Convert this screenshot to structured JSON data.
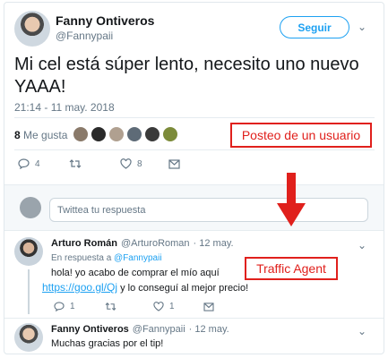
{
  "tweet": {
    "author_name": "Fanny Ontiveros",
    "author_handle": "@Fannypaii",
    "follow_label": "Seguir",
    "text": "Mi cel está súper lento, necesito uno nuevo YAAA!",
    "timestamp": "21:14 - 11 may. 2018",
    "likes_number": "8",
    "likes_label": "Me gusta",
    "reply_count": "4",
    "retweet_count": "",
    "like_count": "8"
  },
  "annotations": {
    "user_post": "Posteo de un usuario",
    "traffic_agent": "Traffic Agent"
  },
  "reply_composer": {
    "placeholder": "Twittea tu respuesta"
  },
  "reply1": {
    "author_name": "Arturo Román",
    "author_handle": "@ArturoRoman",
    "time": "· 12 may.",
    "in_reply_prefix": "En respuesta a",
    "in_reply_handle": "@Fannypaii",
    "line1": "hola! yo acabo de comprar el mío aquí",
    "link": "https://goo.gl/Qj",
    "line2_rest": "y lo conseguí al mejor precio!",
    "reply_count": "1",
    "like_count": "1"
  },
  "reply2": {
    "author_name": "Fanny Ontiveros",
    "author_handle": "@Fannypaii",
    "time": "· 12 may.",
    "text": "Muchas gracias por el tip!"
  },
  "colors": {
    "accent": "#1da1f2",
    "annotation": "#e0201c",
    "muted": "#657786"
  }
}
